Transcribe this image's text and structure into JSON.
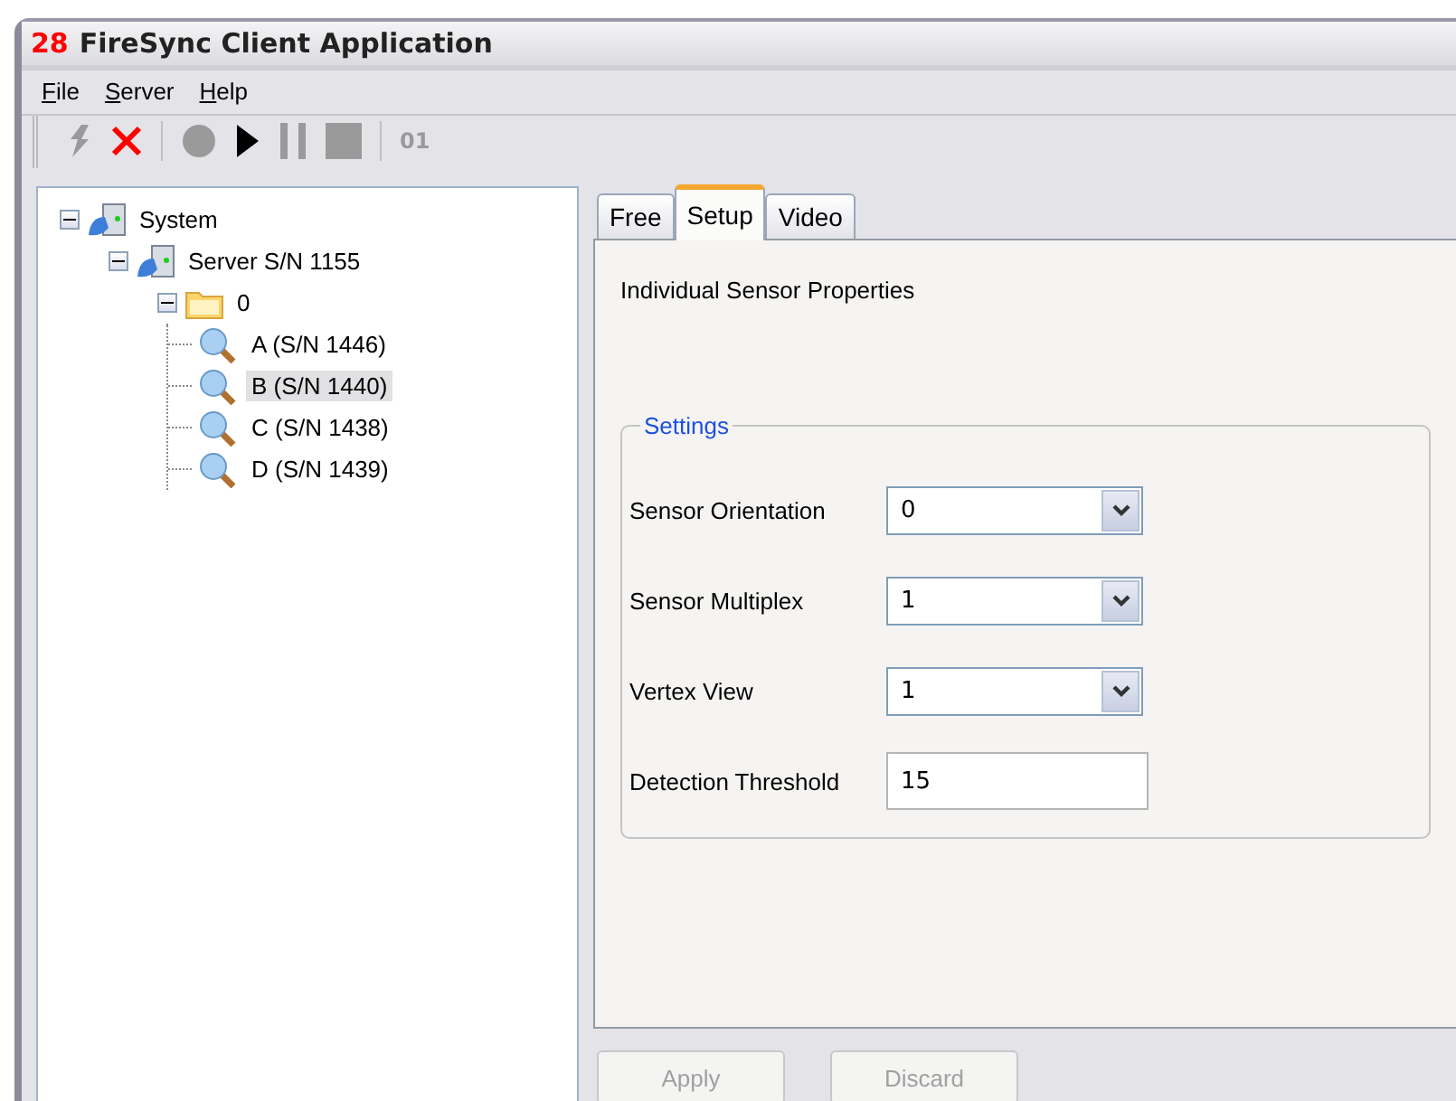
{
  "window": {
    "badge": "28",
    "title": "FireSync Client Application"
  },
  "menu": [
    {
      "label": "File",
      "mnemonic": true
    },
    {
      "label": "Server",
      "mnemonic": true
    },
    {
      "label": "Help",
      "mnemonic": true
    }
  ],
  "toolbar": [
    {
      "kind": "connect",
      "disabled": true
    },
    {
      "kind": "remove",
      "disabled": false
    },
    {
      "kind": "separator"
    },
    {
      "kind": "record",
      "disabled": true
    },
    {
      "kind": "play",
      "disabled": false
    },
    {
      "kind": "pause",
      "disabled": true
    },
    {
      "kind": "stop",
      "disabled": true
    },
    {
      "kind": "separator"
    },
    {
      "kind": "text",
      "label": "01",
      "disabled": true
    }
  ],
  "tree": [
    {
      "kind": "server",
      "label": "System",
      "expanded": true,
      "selected": false,
      "children": [
        {
          "kind": "server",
          "label": "Server S/N 1155",
          "expanded": true,
          "selected": false,
          "children": [
            {
              "kind": "folder",
              "label": "0",
              "expanded": true,
              "selected": false,
              "children": [
                {
                  "kind": "sensor",
                  "label": "A (S/N 1446)",
                  "selected": false
                },
                {
                  "kind": "sensor",
                  "label": "B (S/N 1440)",
                  "selected": true
                },
                {
                  "kind": "sensor",
                  "label": "C (S/N 1438)",
                  "selected": false
                },
                {
                  "kind": "sensor",
                  "label": "D (S/N 1439)",
                  "selected": false
                }
              ]
            }
          ]
        }
      ]
    }
  ],
  "tabs": [
    {
      "label": "Free",
      "selected": false
    },
    {
      "label": "Setup",
      "selected": true
    },
    {
      "label": "Video",
      "selected": false
    }
  ],
  "heading": "Individual Sensor Properties",
  "settings": {
    "legend": "Settings",
    "fields": [
      {
        "kind": "select",
        "label": "Sensor Orientation",
        "value": "0"
      },
      {
        "kind": "select",
        "label": "Sensor Multiplex",
        "value": "1"
      },
      {
        "kind": "select",
        "label": "Vertex View",
        "value": "1"
      },
      {
        "kind": "text",
        "label": "Detection Threshold",
        "value": "15"
      }
    ]
  },
  "buttons": [
    {
      "label": "Apply",
      "disabled": true
    },
    {
      "label": "Discard",
      "disabled": true
    }
  ]
}
